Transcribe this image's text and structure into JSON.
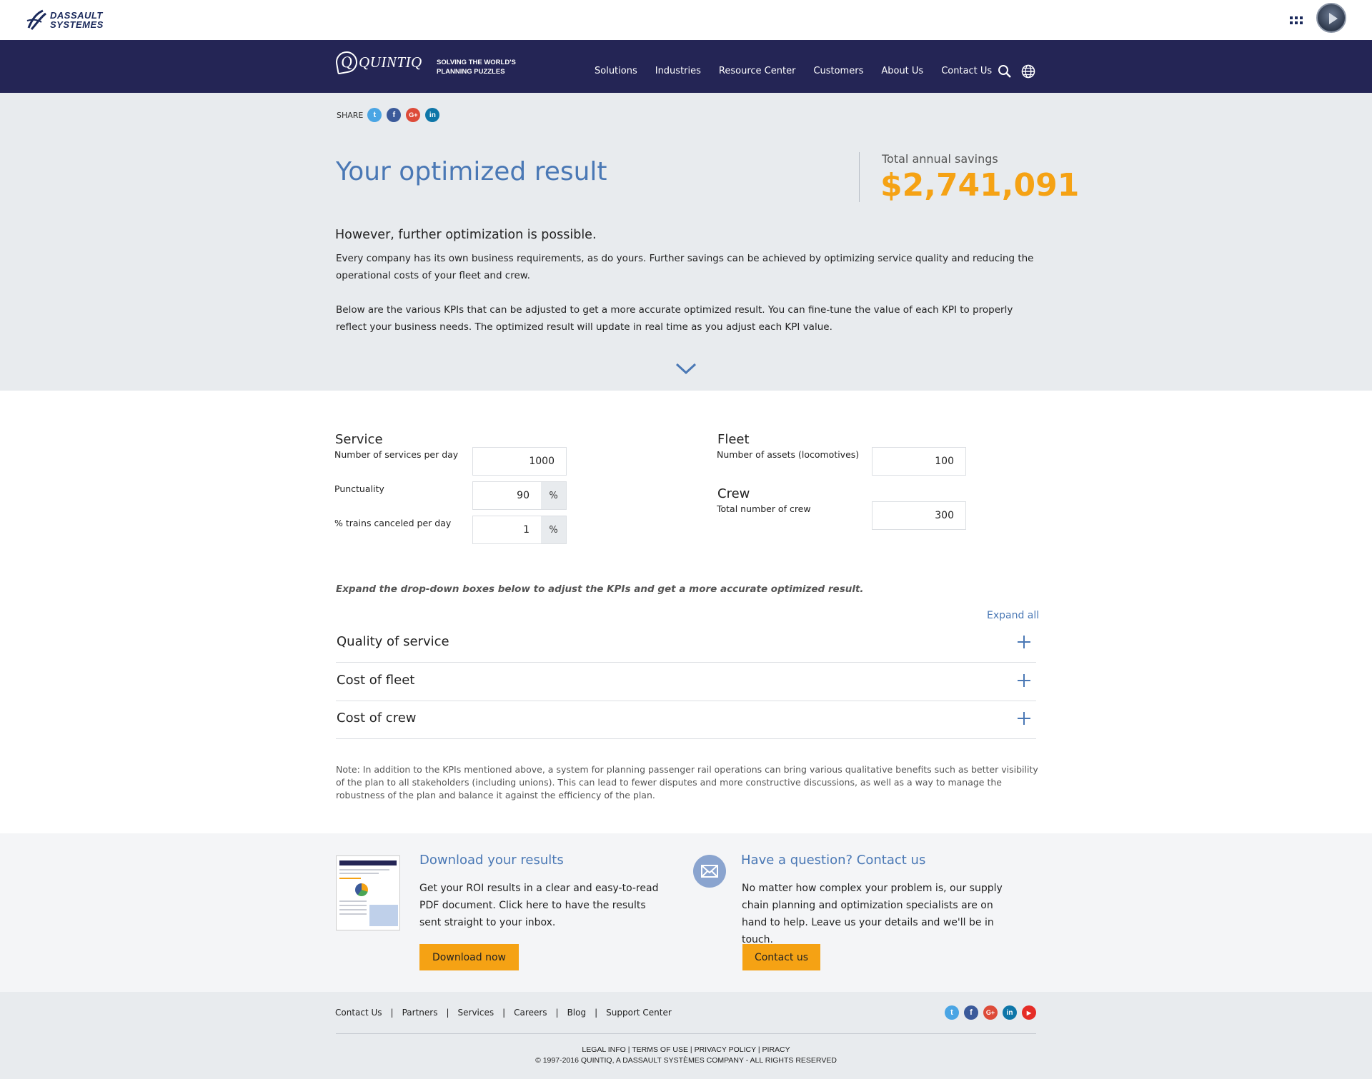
{
  "brand": {
    "ds_text_line1": "DASSAULT",
    "ds_text_line2": "SYSTEMES",
    "quintiq_name": "QUINTIQ",
    "tagline_line1": "SOLVING THE WORLD'S",
    "tagline_line2": "PLANNING PUZZLES"
  },
  "nav": {
    "items": [
      "Solutions",
      "Industries",
      "Resource Center",
      "Customers",
      "About Us",
      "Contact Us"
    ],
    "icons": [
      "search-icon",
      "globe-icon"
    ]
  },
  "hero": {
    "share_label": "SHARE",
    "share_icons": [
      "twitter-icon",
      "facebook-icon",
      "google-plus-icon",
      "linkedin-icon"
    ],
    "title": "Your optimized result",
    "savings_label": "Total annual savings",
    "savings_value": "$2,741,091",
    "subheading": "However, further optimization is possible.",
    "para1": "Every company has its own business requirements, as do yours. Further savings can be achieved by optimizing service quality and reducing the operational costs of your fleet and crew.",
    "para2": "Below are the various KPIs that can be adjusted to get a more accurate optimized result. You can fine-tune the value of each KPI to properly reflect your business needs. The optimized result will update in real time as you adjust each KPI value."
  },
  "kpis": {
    "service": {
      "title": "Service",
      "fields": [
        {
          "label": "Number of services per day",
          "value": "1000",
          "unit": ""
        },
        {
          "label": "Punctuality",
          "value": "90",
          "unit": "%"
        },
        {
          "label": "% trains canceled per day",
          "value": "1",
          "unit": "%"
        }
      ]
    },
    "fleet": {
      "title": "Fleet",
      "fields": [
        {
          "label": "Number of assets (locomotives)",
          "value": "100",
          "unit": ""
        }
      ]
    },
    "crew": {
      "title": "Crew",
      "fields": [
        {
          "label": "Total number of crew",
          "value": "300",
          "unit": ""
        }
      ]
    }
  },
  "accordion": {
    "hint": "Expand the drop-down boxes below to adjust the KPIs and get a more accurate optimized result.",
    "expand_all": "Expand all",
    "items": [
      "Quality of service",
      "Cost of fleet",
      "Cost of crew"
    ]
  },
  "note": "Note: In addition to the KPIs mentioned above, a system for planning passenger rail operations can bring various qualitative benefits such as better visibility of the plan to all stakeholders (including unions). This can lead to fewer disputes and more constructive discussions, as well as a way to manage the robustness of the plan and balance it against the efficiency of the plan.",
  "cta": {
    "download": {
      "title": "Download your results",
      "text": "Get your ROI results in a clear and easy-to-read PDF document. Click here to have the results sent straight to your inbox.",
      "button": "Download now"
    },
    "contact": {
      "title": "Have a question? Contact us",
      "text": "No matter how complex your problem is, our supply chain planning and optimization specialists are on hand to help. Leave us your details and we'll be in touch.",
      "button": "Contact us"
    }
  },
  "footer": {
    "links": [
      "Contact Us",
      "Partners",
      "Services",
      "Careers",
      "Blog",
      "Support Center"
    ],
    "separator": "|",
    "social_icons": [
      "twitter-icon",
      "facebook-icon",
      "google-plus-icon",
      "linkedin-icon",
      "youtube-icon"
    ],
    "legal_links": [
      "LEGAL INFO",
      "TERMS OF USE",
      "PRIVACY POLICY",
      "PIRACY"
    ],
    "copyright": "© 1997-2016 QUINTIQ, A DASSAULT SYSTÈMES COMPANY - ALL RIGHTS RESERVED"
  },
  "colors": {
    "nav_bg": "#242555",
    "accent_blue": "#4a78b5",
    "savings_orange": "#f5a214",
    "hero_bg": "#e8ebee"
  }
}
